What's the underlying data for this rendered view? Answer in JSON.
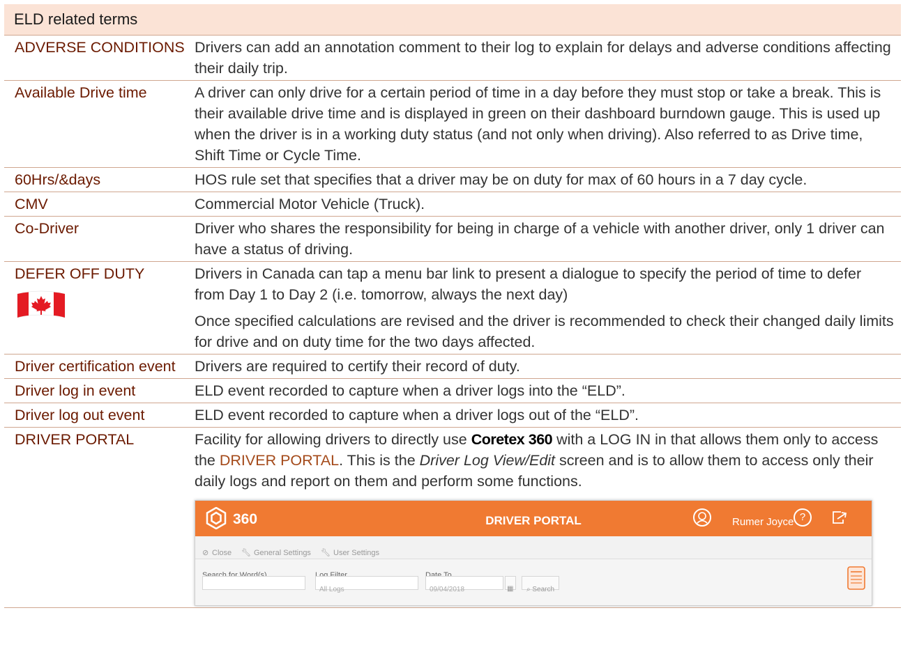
{
  "header": {
    "title": "ELD related terms"
  },
  "rows": [
    {
      "term": "ADVERSE CONDITIONS",
      "def": "Drivers can add an annotation comment to their log to explain for delays and adverse conditions affecting their daily trip."
    },
    {
      "term": "Available Drive time",
      "def": "A driver can only drive for a certain period of time in a day before they must stop or take a break. This is their available drive time and is displayed in green on their dashboard burndown gauge. This is used up when the driver is in a working duty status (and not only when driving). Also referred to as Drive time, Shift Time or Cycle Time."
    },
    {
      "term": "60Hrs/&days",
      "def": "HOS rule set that specifies that a driver may be on duty for max of 60 hours in a 7 day cycle."
    },
    {
      "term": "CMV",
      "def": "Commercial Motor Vehicle (Truck)."
    },
    {
      "term": "Co-Driver",
      "def": "Driver who shares the responsibility for being in charge of a vehicle with another driver, only 1 driver can have a status of driving."
    },
    {
      "term": "DEFER OFF DUTY",
      "def": "Drivers in Canada can tap a menu bar link to present a dialogue to specify the period of time to defer from Day 1 to Day 2 (i.e. tomorrow, always the next day)",
      "def2": "Once specified calculations are revised and the driver is recommended to check their changed daily limits for drive and on duty time for the two days affected.",
      "icon": "canada-flag-icon"
    },
    {
      "term": "Driver certification event",
      "def": "Drivers are required to certify their record of duty."
    },
    {
      "term": "Driver log in event",
      "def": "ELD event recorded to capture when a driver logs into the “ELD”."
    },
    {
      "term": "Driver log out event",
      "def": "ELD event recorded to capture when a driver logs out of the “ELD”."
    },
    {
      "term": "DRIVER PORTAL",
      "def_parts": {
        "a": "Facility for allowing drivers to directly use ",
        "brand": "Coretex 360",
        "b": " with a LOG IN in that allows them only to access the ",
        "portal": "DRIVER PORTAL",
        "c": ". This is the ",
        "italic": "Driver Log View/Edit",
        "d": " screen and is to allow them to access only their daily logs and report on them and perform some functions."
      }
    }
  ],
  "screenshot": {
    "logo_text": "360",
    "title": "DRIVER PORTAL",
    "user_name": "Rumer Joyce",
    "help_glyph": "?",
    "toolbar": {
      "close": "Close",
      "general": "General Settings",
      "user": "User Settings"
    },
    "form": {
      "search_label": "Search for Word(s)",
      "log_filter_label": "Log Filter",
      "log_filter_value": "All Logs",
      "date_to_label": "Date To",
      "date_to_value": "09/04/2018",
      "search_button": "Search"
    },
    "colors": {
      "accent": "#f07a32"
    },
    "icons": [
      "logo-icon",
      "avatar-icon",
      "help-icon",
      "logout-icon",
      "close-icon",
      "wrench-icon",
      "calendar-icon",
      "search-icon",
      "log-book-icon"
    ]
  }
}
